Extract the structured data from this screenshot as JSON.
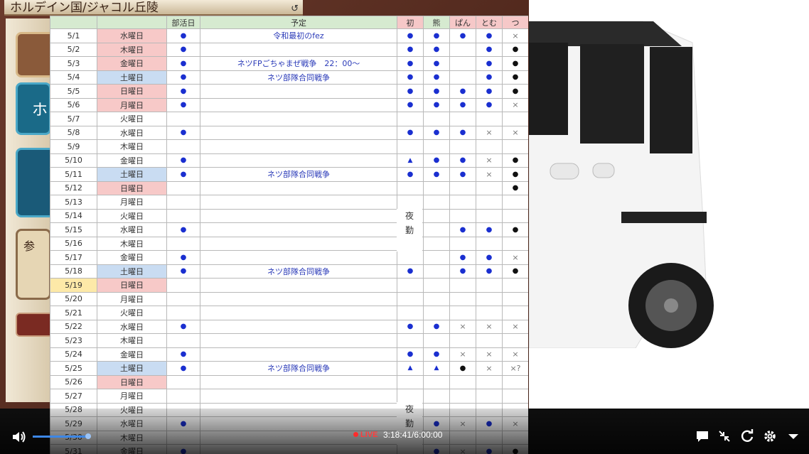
{
  "game": {
    "location_title": "ホルデイン国/ジャコル丘陵",
    "side_button_text": "ホ",
    "side_label": "参"
  },
  "schedule": {
    "headers": [
      "",
      "",
      "部活日",
      "予定",
      "初",
      "熊",
      "ぱん",
      "とむ",
      "つ"
    ],
    "night_label": "夜勤",
    "rows": [
      {
        "date": "5/1",
        "day": "水曜日",
        "day_color": "red",
        "active": "●",
        "event": "令和最初のfez",
        "c1": "●",
        "c2": "●",
        "c3": "●",
        "c4": "●",
        "c5": "×"
      },
      {
        "date": "5/2",
        "day": "木曜日",
        "day_color": "red",
        "active": "●",
        "event": "",
        "c1": "●",
        "c2": "●",
        "c3": "",
        "c4": "●",
        "c5": "●"
      },
      {
        "date": "5/3",
        "day": "金曜日",
        "day_color": "red",
        "active": "●",
        "event": "ネツFPごちゃまぜ戦争　22：00～",
        "c1": "●",
        "c2": "●",
        "c3": "",
        "c4": "●",
        "c5": "●"
      },
      {
        "date": "5/4",
        "day": "土曜日",
        "day_color": "blue",
        "active": "●",
        "event": "ネツ部隊合同戦争",
        "c1": "●",
        "c2": "●",
        "c3": "",
        "c4": "●",
        "c5": "●"
      },
      {
        "date": "5/5",
        "day": "日曜日",
        "day_color": "red",
        "active": "●",
        "event": "",
        "c1": "●",
        "c2": "●",
        "c3": "●",
        "c4": "●",
        "c5": "●"
      },
      {
        "date": "5/6",
        "day": "月曜日",
        "day_color": "red",
        "active": "●",
        "event": "",
        "c1": "●",
        "c2": "●",
        "c3": "●",
        "c4": "●",
        "c5": "×"
      },
      {
        "date": "5/7",
        "day": "火曜日",
        "day_color": "",
        "active": "",
        "event": "",
        "c1": "",
        "c2": "",
        "c3": "",
        "c4": "",
        "c5": ""
      },
      {
        "date": "5/8",
        "day": "水曜日",
        "day_color": "",
        "active": "●",
        "event": "",
        "c1": "●",
        "c2": "●",
        "c3": "●",
        "c4": "×",
        "c5": "×"
      },
      {
        "date": "5/9",
        "day": "木曜日",
        "day_color": "",
        "active": "",
        "event": "",
        "c1": "",
        "c2": "",
        "c3": "",
        "c4": "",
        "c5": ""
      },
      {
        "date": "5/10",
        "day": "金曜日",
        "day_color": "",
        "active": "●",
        "event": "",
        "c1": "▲",
        "c2": "●",
        "c3": "●",
        "c4": "×",
        "c5": "●"
      },
      {
        "date": "5/11",
        "day": "土曜日",
        "day_color": "blue",
        "active": "●",
        "event": "ネツ部隊合同戦争",
        "c1": "●",
        "c2": "●",
        "c3": "●",
        "c4": "×",
        "c5": "●"
      },
      {
        "date": "5/12",
        "day": "日曜日",
        "day_color": "red",
        "active": "",
        "event": "",
        "c1": "",
        "c2": "",
        "c3": "",
        "c4": "",
        "c5": "●"
      },
      {
        "date": "5/13",
        "day": "月曜日",
        "day_color": "",
        "active": "",
        "event": "",
        "c1": "",
        "c2": "",
        "c3": "",
        "c4": "",
        "c5": ""
      },
      {
        "date": "5/14",
        "day": "火曜日",
        "day_color": "",
        "active": "",
        "event": "",
        "c1": "",
        "c2": "",
        "c3": "",
        "c4": "",
        "c5": ""
      },
      {
        "date": "5/15",
        "day": "水曜日",
        "day_color": "",
        "active": "●",
        "event": "",
        "c1": "",
        "c2": "",
        "c3": "●",
        "c4": "●",
        "c5": "●"
      },
      {
        "date": "5/16",
        "day": "木曜日",
        "day_color": "",
        "active": "",
        "event": "",
        "c1": "",
        "c2": "",
        "c3": "",
        "c4": "",
        "c5": ""
      },
      {
        "date": "5/17",
        "day": "金曜日",
        "day_color": "",
        "active": "●",
        "event": "",
        "c1": "",
        "c2": "",
        "c3": "●",
        "c4": "●",
        "c5": "×"
      },
      {
        "date": "5/18",
        "day": "土曜日",
        "day_color": "blue",
        "active": "●",
        "event": "ネツ部隊合同戦争",
        "c1": "●",
        "c2": "",
        "c3": "●",
        "c4": "●",
        "c5": "●"
      },
      {
        "date": "5/19",
        "day": "日曜日",
        "day_color": "red",
        "active": "",
        "event": "",
        "c1": "",
        "c2": "",
        "c3": "",
        "c4": "",
        "c5": "",
        "date_color": "yellow"
      },
      {
        "date": "5/20",
        "day": "月曜日",
        "day_color": "",
        "active": "",
        "event": "",
        "c1": "",
        "c2": "",
        "c3": "",
        "c4": "",
        "c5": ""
      },
      {
        "date": "5/21",
        "day": "火曜日",
        "day_color": "",
        "active": "",
        "event": "",
        "c1": "",
        "c2": "",
        "c3": "",
        "c4": "",
        "c5": ""
      },
      {
        "date": "5/22",
        "day": "水曜日",
        "day_color": "",
        "active": "●",
        "event": "",
        "c1": "●",
        "c2": "●",
        "c3": "×",
        "c4": "×",
        "c5": "×"
      },
      {
        "date": "5/23",
        "day": "木曜日",
        "day_color": "",
        "active": "",
        "event": "",
        "c1": "",
        "c2": "",
        "c3": "",
        "c4": "",
        "c5": ""
      },
      {
        "date": "5/24",
        "day": "金曜日",
        "day_color": "",
        "active": "●",
        "event": "",
        "c1": "●",
        "c2": "●",
        "c3": "×",
        "c4": "×",
        "c5": "×"
      },
      {
        "date": "5/25",
        "day": "土曜日",
        "day_color": "blue",
        "active": "●",
        "event": "ネツ部隊合同戦争",
        "c1": "▲",
        "c2": "▲",
        "c3": "●",
        "c4": "×",
        "c5": "×?"
      },
      {
        "date": "5/26",
        "day": "日曜日",
        "day_color": "red",
        "active": "",
        "event": "",
        "c1": "",
        "c2": "",
        "c3": "",
        "c4": "",
        "c5": ""
      },
      {
        "date": "5/27",
        "day": "月曜日",
        "day_color": "",
        "active": "",
        "event": "",
        "c1": "",
        "c2": "",
        "c3": "",
        "c4": "",
        "c5": ""
      },
      {
        "date": "5/28",
        "day": "火曜日",
        "day_color": "",
        "active": "",
        "event": "",
        "c1": "",
        "c2": "",
        "c3": "",
        "c4": "",
        "c5": ""
      },
      {
        "date": "5/29",
        "day": "水曜日",
        "day_color": "",
        "active": "●",
        "event": "",
        "c1": "",
        "c2": "●",
        "c3": "×",
        "c4": "●",
        "c5": "×"
      },
      {
        "date": "5/30",
        "day": "木曜日",
        "day_color": "",
        "active": "",
        "event": "",
        "c1": "",
        "c2": "",
        "c3": "",
        "c4": "",
        "c5": ""
      },
      {
        "date": "5/31",
        "day": "金曜日",
        "day_color": "",
        "active": "●",
        "event": "",
        "c1": "",
        "c2": "●",
        "c3": "×",
        "c4": "●",
        "c5": "●"
      }
    ]
  },
  "player": {
    "live_label": "LIVE",
    "time_current": "3:18:41",
    "time_total": "6:00:00",
    "volume_fraction": 0.96
  }
}
